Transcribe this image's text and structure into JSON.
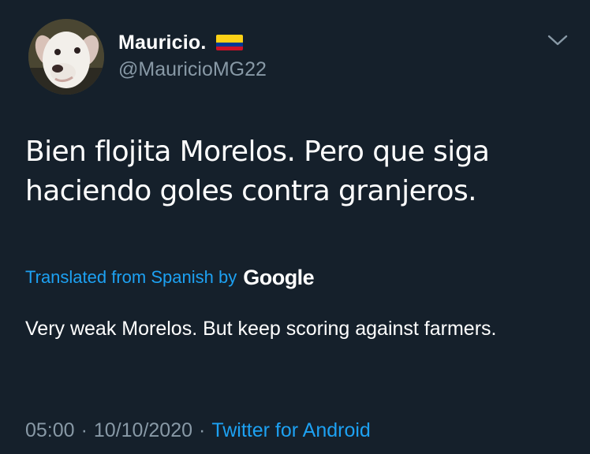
{
  "user": {
    "display_name": "Mauricio.",
    "handle": "@MauricioMG22",
    "flag_icon": "colombia-flag-icon",
    "flag_colors": [
      "#FCD116",
      "#003893",
      "#CE1126"
    ]
  },
  "menu_icon": "chevron-down-icon",
  "tweet": {
    "text": "Bien flojita Morelos. Pero que siga haciendo goles contra granjeros.",
    "translated_from_label": "Translated from Spanish by",
    "translator_brand": "Google",
    "translation": "Very weak Morelos. But keep scoring against farmers.",
    "time": "05:00",
    "separator": "·",
    "date": "10/10/2020",
    "source": "Twitter for Android"
  },
  "colors": {
    "background": "#15202b",
    "text": "#ffffff",
    "secondary": "#8899a6",
    "accent": "#1da1f2"
  }
}
